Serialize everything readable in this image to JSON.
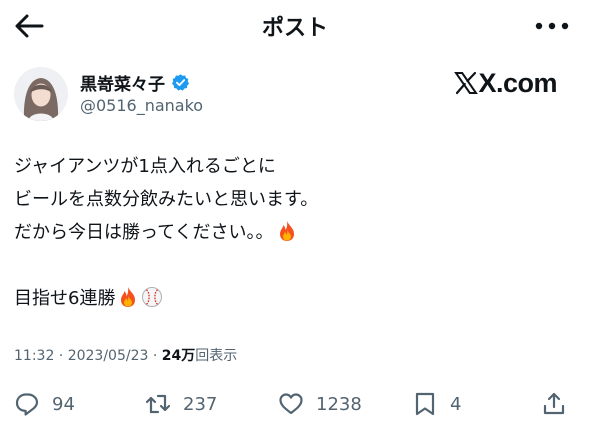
{
  "header": {
    "title": "ポスト",
    "back_icon": "arrow-left-icon",
    "more_icon": "more-horizontal-icon"
  },
  "author": {
    "name": "黒嵜菜々子",
    "handle": "@0516_nanako",
    "verified_icon": "verified-badge-icon",
    "verified_color": "#1d9bf0"
  },
  "watermark": {
    "text": "X.com"
  },
  "post": {
    "lines": [
      "ジャイアンツが1点入れるごとに",
      "ビールを点数分飲みたいと思います。",
      "だから今日は勝ってください。。"
    ],
    "line4": "目指せ6連勝",
    "emojis": [
      "fire-emoji",
      "fire-emoji",
      "baseball-emoji"
    ]
  },
  "meta": {
    "time_date": "11:32 · 2023/05/23 · ",
    "views_count": "24万",
    "views_label": "回表示"
  },
  "actions": {
    "replies": "94",
    "reposts": "237",
    "likes": "1238",
    "bookmarks": "4"
  },
  "colors": {
    "text": "#0f1419",
    "secondary": "#536471",
    "accent": "#1d9bf0"
  }
}
